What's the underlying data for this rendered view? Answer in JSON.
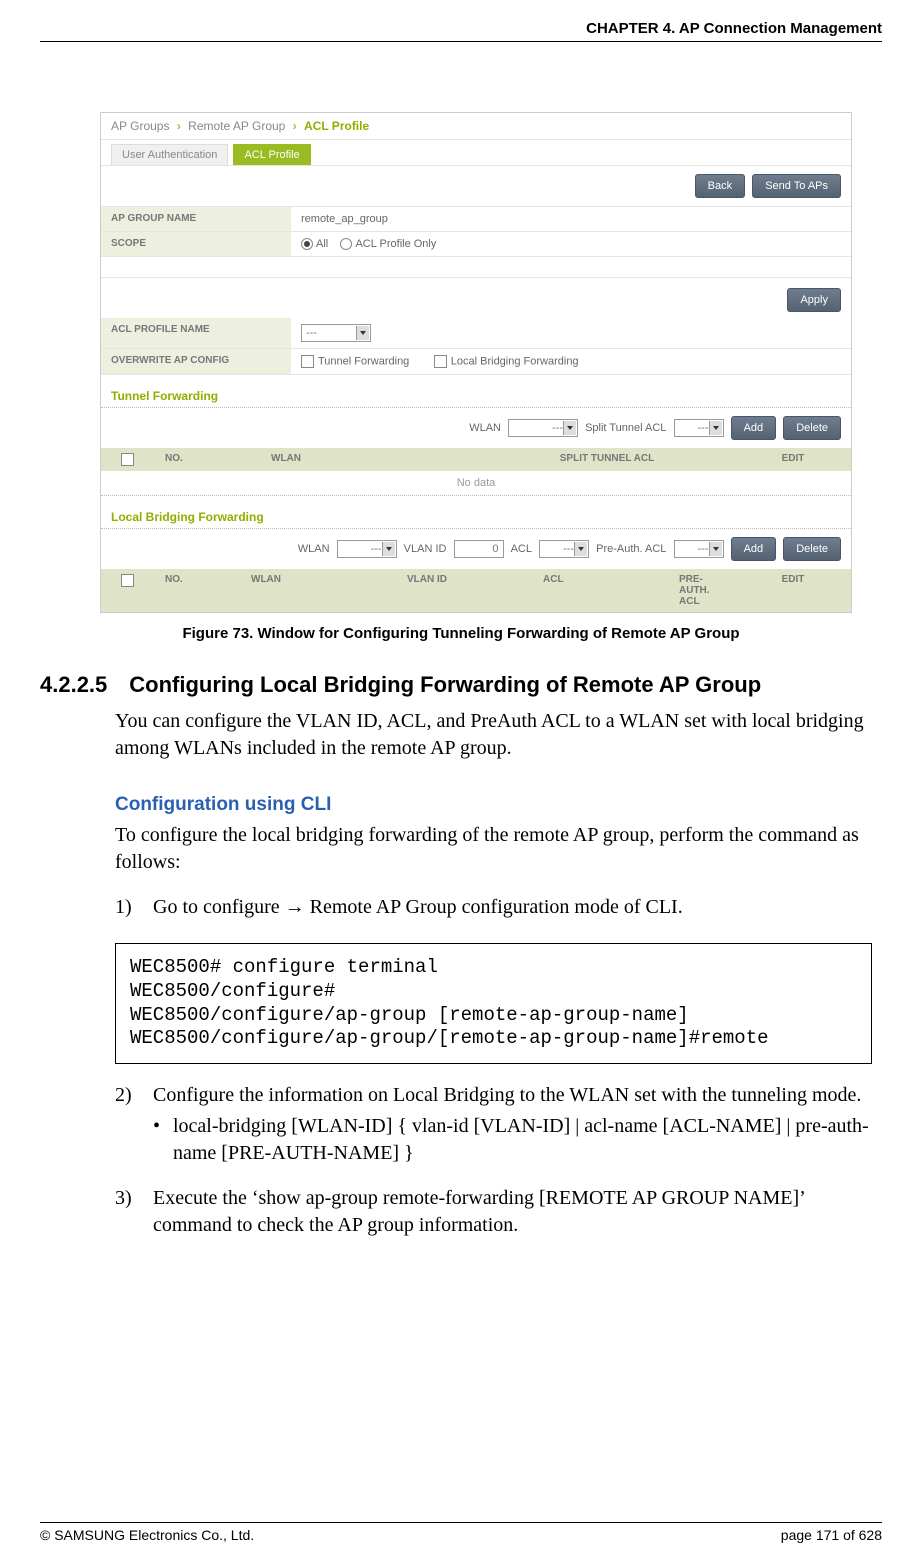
{
  "header": {
    "chapter": "CHAPTER 4. AP Connection Management"
  },
  "ui": {
    "breadcrumb": {
      "a": "AP Groups",
      "b": "Remote AP Group",
      "c": "ACL Profile"
    },
    "tabs": {
      "t1": "User Authentication",
      "t2": "ACL Profile"
    },
    "buttons": {
      "back": "Back",
      "send": "Send To APs",
      "apply": "Apply",
      "add": "Add",
      "delete": "Delete"
    },
    "rows": {
      "group_name_k": "AP GROUP NAME",
      "group_name_v": "remote_ap_group",
      "scope_k": "SCOPE",
      "scope_all": "All",
      "scope_only": "ACL Profile Only",
      "profile_k": "ACL PROFILE NAME",
      "profile_v": "---",
      "overwrite_k": "OVERWRITE AP CONFIG",
      "tf": "Tunnel Forwarding",
      "lbf": "Local Bridging Forwarding"
    },
    "tunnel": {
      "title": "Tunnel Forwarding",
      "wlan_lbl": "WLAN",
      "wlan_v": "---",
      "stacl_lbl": "Split Tunnel ACL",
      "stacl_v": "---",
      "th_no": "NO.",
      "th_wlan": "WLAN",
      "th_stacl": "SPLIT TUNNEL ACL",
      "th_edit": "EDIT",
      "nodata": "No data"
    },
    "local": {
      "title": "Local Bridging Forwarding",
      "wlan_lbl": "WLAN",
      "wlan_v": "---",
      "vlan_lbl": "VLAN ID",
      "vlan_v": "0",
      "acl_lbl": "ACL",
      "acl_v": "---",
      "pre_lbl": "Pre-Auth. ACL",
      "pre_v": "---",
      "th_no": "NO.",
      "th_wlan": "WLAN",
      "th_vlan": "VLAN ID",
      "th_acl": "ACL",
      "th_pre": "PRE-AUTH. ACL",
      "th_edit": "EDIT"
    }
  },
  "figcap": "Figure 73. Window for Configuring Tunneling Forwarding of Remote AP Group",
  "section": {
    "num": "4.2.2.5",
    "title": "Configuring Local Bridging Forwarding of Remote AP Group",
    "p1": "You can configure the VLAN ID, ACL, and PreAuth ACL to a WLAN set with local bridging among WLANs included in the remote AP group."
  },
  "cli": {
    "title": "Configuration using CLI",
    "p": "To configure the local bridging forwarding of the remote AP group, perform the command as follows:",
    "steps": {
      "s1": "Go to configure → Remote AP Group configuration mode of CLI.",
      "s2": "Configure the information on Local Bridging to the WLAN set with the tunneling mode.",
      "s2b": "local-bridging [WLAN-ID] { vlan-id [VLAN-ID] | acl-name [ACL-NAME] | pre-auth-name [PRE-AUTH-NAME] }",
      "s3": "Execute the ‘show ap-group remote-forwarding [REMOTE AP GROUP NAME]’ command to check the AP group information."
    },
    "code": "WEC8500# configure terminal\nWEC8500/configure#\nWEC8500/configure/ap-group [remote-ap-group-name]\nWEC8500/configure/ap-group/[remote-ap-group-name]#remote"
  },
  "footer": {
    "copyright": "© SAMSUNG Electronics Co., Ltd.",
    "page": "page 171 of 628"
  }
}
